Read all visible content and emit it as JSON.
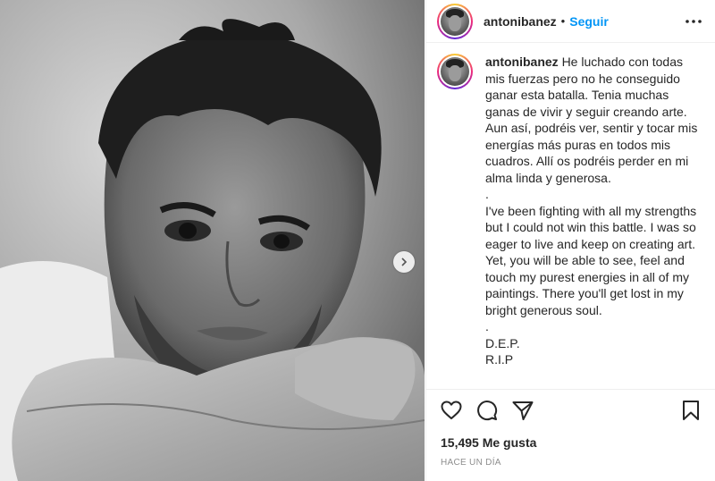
{
  "post": {
    "username": "antonibanez",
    "separator": "•",
    "follow_label": "Seguir",
    "caption_spanish": "He luchado con todas mis fuerzas pero no he conseguido ganar esta batalla. Tenia muchas ganas de vivir y seguir creando arte. Aun así, podréis ver, sentir y tocar mis energías más puras en todos mis cuadros. Allí os podréis perder en mi alma linda y generosa.",
    "caption_dot_1": ".",
    "caption_english": "I've been fighting with all my strengths but I could not win this battle. I was so eager to live and keep on creating art. Yet, you will be able to see, feel and touch my purest energies in all of my paintings. There you'll get lost in my bright generous soul.",
    "caption_dot_2": ".",
    "caption_dep": "D.E.P.",
    "caption_rip": "R.I.P",
    "likes": "15,495 Me gusta",
    "timestamp": "HACE UN DÍA"
  },
  "icons": {
    "more": "more-horizontal-icon",
    "like": "heart-icon",
    "comment": "comment-icon",
    "share": "send-icon",
    "save": "bookmark-icon",
    "next": "chevron-right-icon"
  },
  "colors": {
    "follow": "#0095f6",
    "text": "#262626",
    "muted": "#8e8e8e"
  }
}
